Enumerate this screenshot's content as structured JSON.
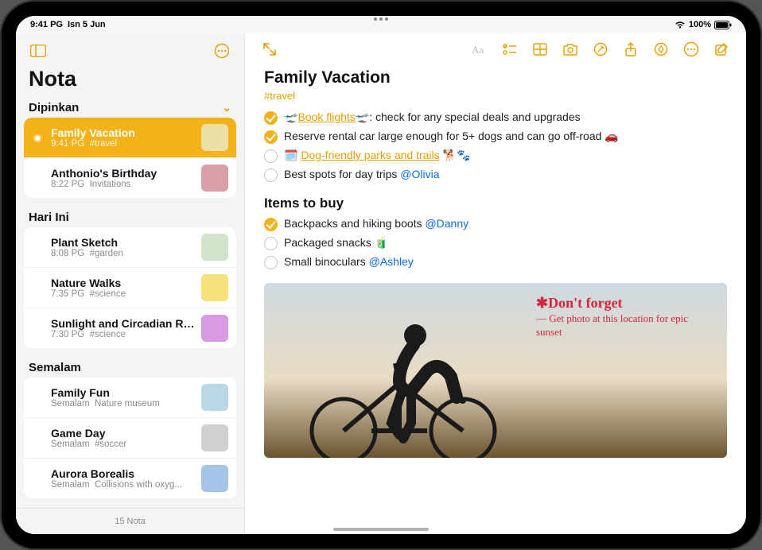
{
  "status": {
    "time": "9:41 PG",
    "date": "Isn 5 Jun",
    "battery": "100%"
  },
  "sidebar": {
    "title": "Nota",
    "footer": "15 Nota",
    "sections": [
      {
        "name": "Dipinkan",
        "items": [
          {
            "title": "Family Vacation",
            "time": "9:41 PG",
            "tag": "#travel",
            "selected": true,
            "pinned": true,
            "thumbColor": "#eadfa5"
          },
          {
            "title": "Anthonio's Birthday",
            "time": "8:22 PG",
            "tag": "Invitations",
            "thumbColor": "#d99fa8"
          }
        ]
      },
      {
        "name": "Hari Ini",
        "items": [
          {
            "title": "Plant Sketch",
            "time": "8:08 PG",
            "tag": "#garden",
            "thumbColor": "#cfe4c8"
          },
          {
            "title": "Nature Walks",
            "time": "7:35 PG",
            "tag": "#science",
            "thumbColor": "#f5e07a"
          },
          {
            "title": "Sunlight and Circadian Rhy...",
            "time": "7:30 PG",
            "tag": "#science",
            "thumbColor": "#d89ae5"
          }
        ]
      },
      {
        "name": "Semalam",
        "items": [
          {
            "title": "Family Fun",
            "time": "Semalam",
            "tag": "Nature museum",
            "thumbColor": "#b9d7e6"
          },
          {
            "title": "Game Day",
            "time": "Semalam",
            "tag": "#soccer",
            "thumbColor": "#d0d0d0"
          },
          {
            "title": "Aurora Borealis",
            "time": "Semalam",
            "tag": "Collisions with oxyg...",
            "thumbColor": "#a6c4e8"
          }
        ]
      }
    ]
  },
  "note": {
    "title": "Family Vacation",
    "tag": "#travel",
    "checklist1": [
      {
        "done": true,
        "before": "🛫",
        "linkText": "Book flights",
        "afterLink": "🛫: ",
        "text": "check for any special deals and upgrades"
      },
      {
        "done": true,
        "text": "Reserve rental car large enough for 5+ dogs and can go off-road 🚗"
      },
      {
        "done": false,
        "before": "🗓️ ",
        "linkText": "Dog-friendly parks and trails",
        "afterLink": " 🐕🐾"
      },
      {
        "done": false,
        "text": "Best spots for day trips ",
        "mention": "@Olivia"
      }
    ],
    "subhead": "Items to buy",
    "checklist2": [
      {
        "done": true,
        "text": "Backpacks and hiking boots ",
        "mention": "@Danny"
      },
      {
        "done": false,
        "text": "Packaged snacks 🧃"
      },
      {
        "done": false,
        "text": "Small binoculars ",
        "mention": "@Ashley"
      }
    ],
    "handwriting": {
      "line1": "✱Don't forget",
      "line2": "— Get photo at this location for epic sunset"
    }
  }
}
